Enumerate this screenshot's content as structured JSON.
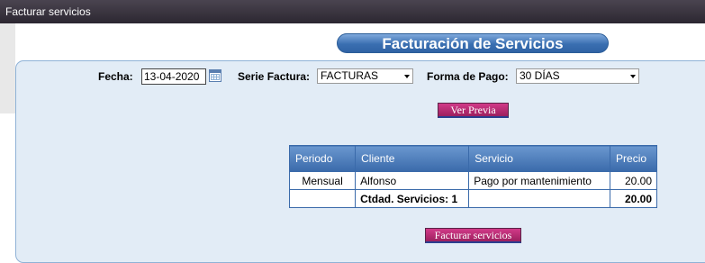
{
  "window": {
    "title": "Facturar servicios"
  },
  "header": {
    "title": "Facturación de Servicios"
  },
  "form": {
    "fecha_label": "Fecha:",
    "fecha_value": "13-04-2020",
    "serie_label": "Serie Factura:",
    "serie_value": "FACTURAS",
    "pago_label": "Forma de Pago:",
    "pago_value": "30 DÍAS"
  },
  "buttons": {
    "preview": "Ver Previa",
    "facturar": "Facturar servicios"
  },
  "table": {
    "columns": [
      "Periodo",
      "Cliente",
      "Servicio",
      "Precio"
    ],
    "rows": [
      {
        "periodo": "Mensual",
        "cliente": "Alfonso",
        "servicio": "Pago por mantenimiento",
        "precio": "20.00"
      }
    ],
    "total": {
      "label": "Ctdad. Servicios: 1",
      "precio": "20.00"
    }
  },
  "colors": {
    "accent": "#3a6aaa",
    "button": "#b22a72",
    "panel": "#e2ecf6"
  }
}
